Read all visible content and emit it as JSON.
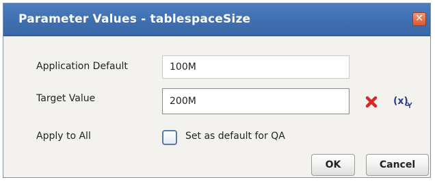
{
  "dialog": {
    "title": "Parameter Values - tablespaceSize",
    "close_icon": "close-icon"
  },
  "fields": {
    "application_default": {
      "label": "Application Default",
      "value": "100M"
    },
    "target_value": {
      "label": "Target Value",
      "value": "200M"
    },
    "apply_to_all": {
      "label": "Apply to All",
      "checkbox_label": "Set as default for QA",
      "checked": false
    }
  },
  "icons": {
    "clear": "clear-x-icon",
    "variable": "variable-icon",
    "variable_glyph": "(x)"
  },
  "buttons": {
    "ok": "OK",
    "cancel": "Cancel"
  },
  "colors": {
    "titlebar": "#3f6fb0",
    "clear_icon": "#d62a2a",
    "variable_icon": "#2a3c86"
  }
}
